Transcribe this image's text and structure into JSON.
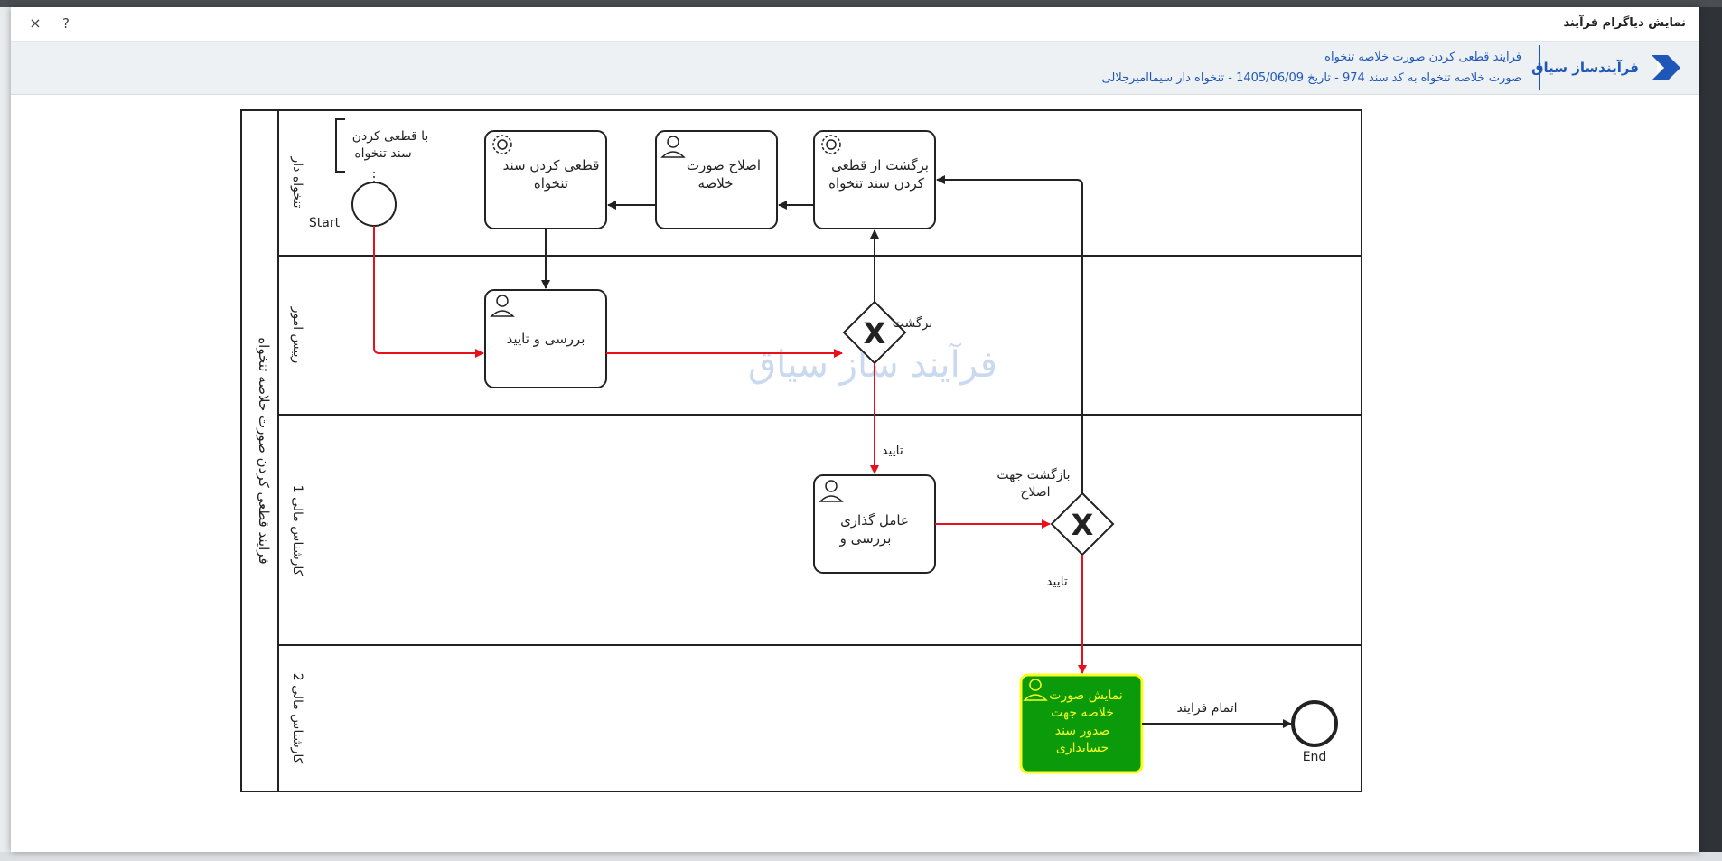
{
  "dialog": {
    "title": "نمایش دیاگرام فرآیند",
    "close_glyph": "×",
    "help_glyph": "?"
  },
  "header": {
    "brand_name": "فرآیندساز سیاق",
    "process_title": "فرایند قطعی کردن صورت خلاصه تنخواه",
    "process_subtitle": "صورت خلاصه تنخواه به کد سند 974 - تاریخ 1405/06/09 - تنخواه دار سیماامیرجلالی"
  },
  "diagram": {
    "pool_label": "فرایند قطعی کردن صورت خلاصه تنخواه",
    "lanes": [
      "تنخواه دار",
      "رییس امور",
      "کارشناس مالی 1",
      "کارشناس مالی 2"
    ],
    "watermark": "فرآیند ساز سیاق",
    "annotation": [
      "با قطعی کردن",
      "سند تنخواه"
    ],
    "start_label": "Start",
    "end_label": "End",
    "tasks": {
      "finalize": [
        "قطعی کردن سند",
        "تنخواه"
      ],
      "fix_summary": [
        "اصلاح صورت",
        "خلاصه"
      ],
      "revert": [
        "برگشت از قطعی",
        "کردن سند تنخواه"
      ],
      "review": [
        "بررسی و تایید"
      ],
      "assign": [
        "عامل گذاری",
        "بررسی و"
      ],
      "show": [
        "نمایش صورت",
        "خلاصه جهت",
        "صدور سند",
        "حسابداری"
      ]
    },
    "flows": {
      "return": "برگشت",
      "approve1": "تایید",
      "return_fix": [
        "بازگشت جهت",
        "اصلاح"
      ],
      "approve2": "تایید",
      "finish": "اتمام فرایند"
    },
    "colors": {
      "active_flow": "#e8101a",
      "flow": "#222222",
      "active_task_fill": "#0a9a0a",
      "active_task_border": "#f6ff1e",
      "active_task_text": "#f6ff1e",
      "watermark": "#c9d9ef"
    }
  }
}
